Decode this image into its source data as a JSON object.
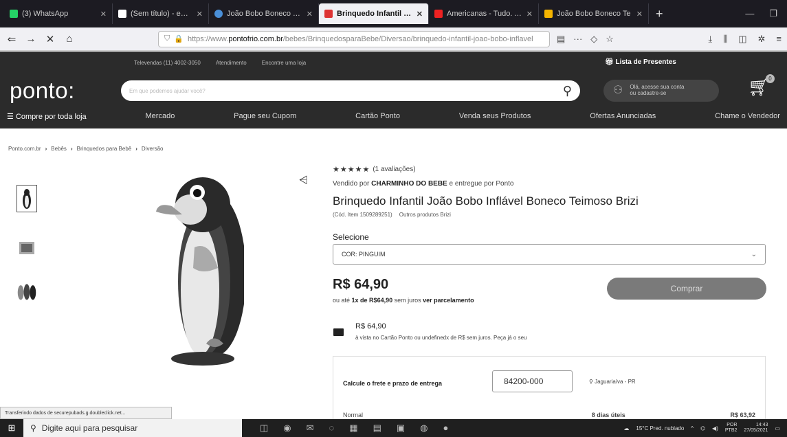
{
  "browser": {
    "tabs": [
      {
        "title": "(3) WhatsApp",
        "active": false
      },
      {
        "title": "(Sem título) - eqnapedi",
        "active": false
      },
      {
        "title": "João Bobo Boneco Tei",
        "active": false
      },
      {
        "title": "Brinquedo Infantil João",
        "active": true
      },
      {
        "title": "Americanas - Tudo. A um",
        "active": false
      },
      {
        "title": "João Bobo Boneco Te",
        "active": false
      }
    ],
    "new_tab": "+",
    "url_prefix": "https://www.",
    "url_domain": "pontofrio.com.br",
    "url_path": "/bebes/BrinquedosparaBebe/Diversao/brinquedo-infantil-joao-bobo-inflavel"
  },
  "site": {
    "toplinks": [
      "Televendas (11) 4002-3050",
      "Atendimento",
      "Encontre uma loja"
    ],
    "gift_list": "Lista de Presentes",
    "logo": "ponto:",
    "search_placeholder": "Em que podemos ajudar você?",
    "account_line1": "Olá, acesse sua conta",
    "account_line2": "ou cadastre-se",
    "cart_count": "0",
    "menu": [
      "Compre por toda loja",
      "Mercado",
      "Pague seu Cupom",
      "Cartão Ponto",
      "Venda seus Produtos",
      "Ofertas Anunciadas",
      "Chame o Vendedor"
    ]
  },
  "breadcrumb": [
    "Ponto.com.br",
    "Bebês",
    "Brinquedos para Bebê",
    "Diversão"
  ],
  "product": {
    "stars": "★★★★★",
    "reviews": "(1 avaliações)",
    "seller_prefix": "Vendido por",
    "seller_name": "CHARMINHO DO BEBE",
    "seller_mid": "e entregue por",
    "seller_deliver": "Ponto",
    "title": "Brinquedo Infantil João Bobo Inflável Boneco Teimoso Brizi",
    "code": "(Cód. Item 1509289251)",
    "other_products": "Outros produtos Brizi",
    "select_label": "Selecione",
    "select_value": "COR: PINGUIM",
    "price": "R$ 64,90",
    "installments_prefix": "ou até",
    "installments_bold": "1x de R$64,90",
    "installments_mid": "sem juros",
    "installments_link": "ver parcelamento",
    "buy_label": "Comprar",
    "card_price": "R$ 64,90",
    "card_note": "à vista no Cartão Ponto ou undefinedx de R$ sem juros. Peça já o seu"
  },
  "freight": {
    "label": "Calcule o frete e prazo de entrega",
    "cep": "84200-000",
    "city": "Jaguariaíva - PR",
    "row_type": "Normal",
    "row_days": "8 dias úteis",
    "row_price": "R$ 63,92"
  },
  "status_text": "Transferindo dados de securepubads.g.doubleclick.net...",
  "taskbar": {
    "search_placeholder": "Digite aqui para pesquisar",
    "weather": "15°C Pred. nublado",
    "lang": "POR",
    "lang2": "PTB2",
    "time": "14:43",
    "date": "27/05/2021"
  }
}
